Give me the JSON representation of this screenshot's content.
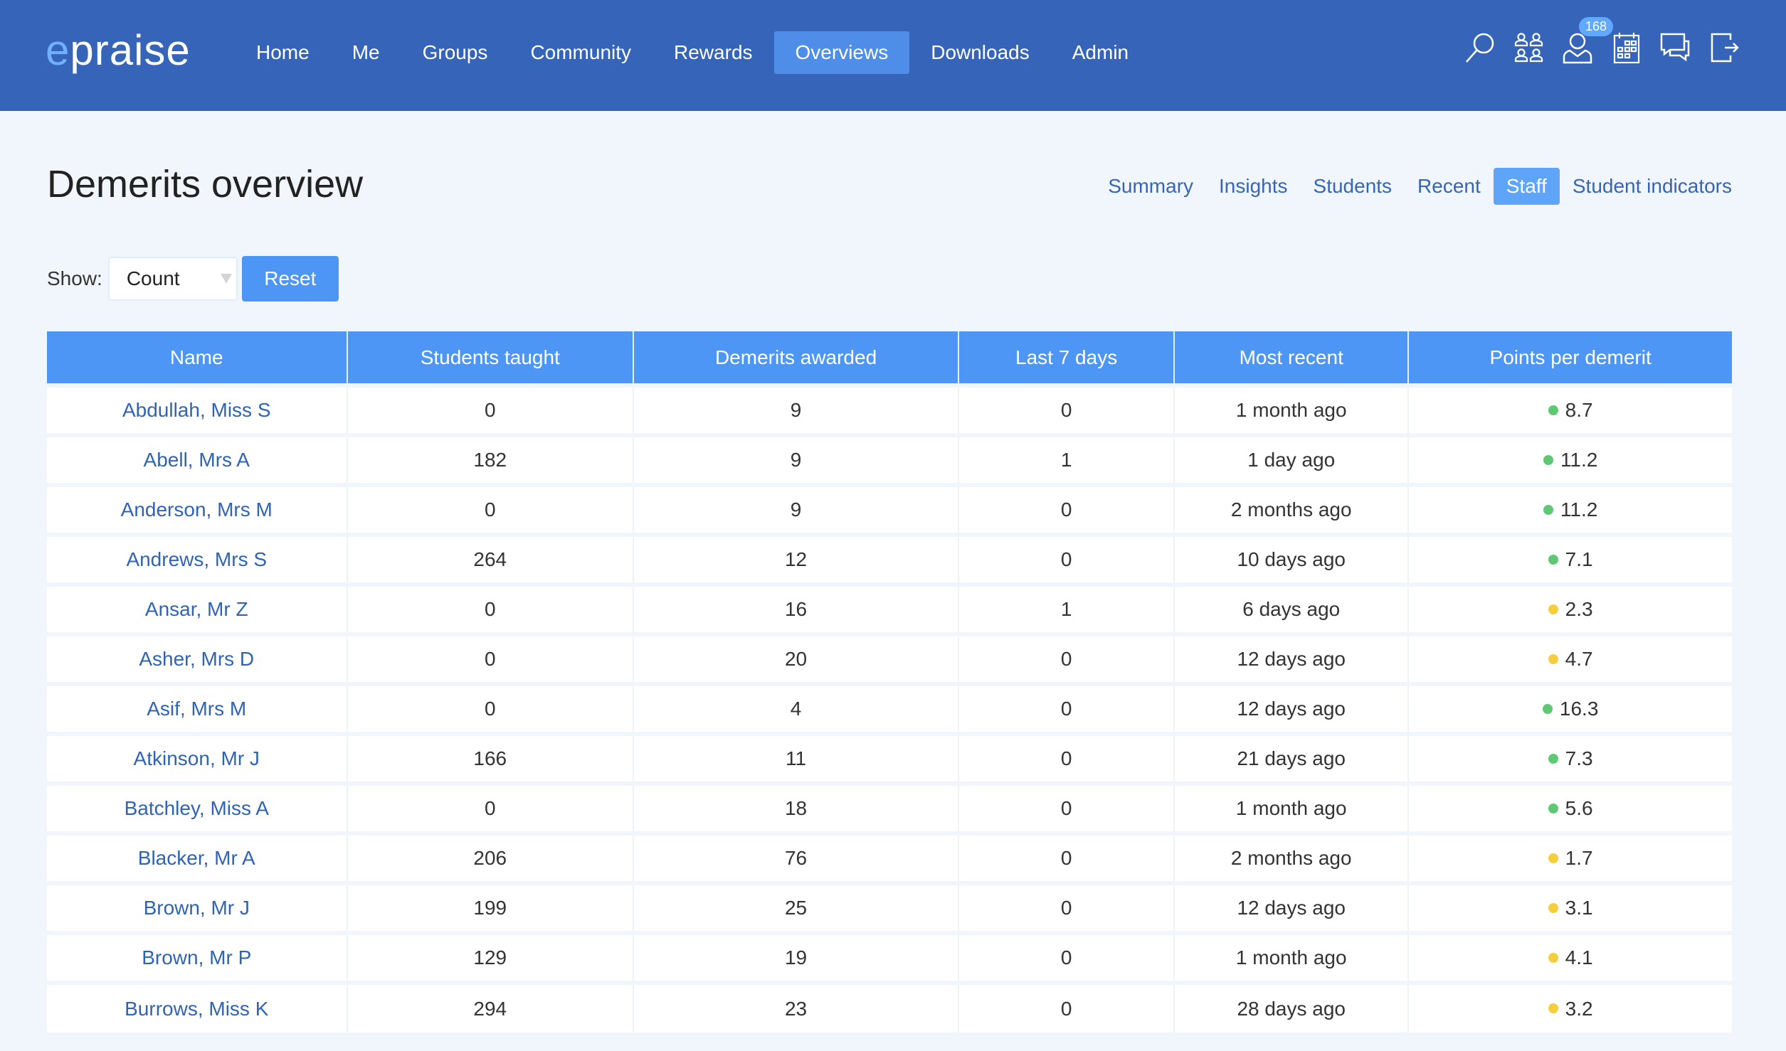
{
  "header": {
    "logo_e": "e",
    "logo_rest": "praise",
    "nav": [
      {
        "label": "Home",
        "active": false
      },
      {
        "label": "Me",
        "active": false
      },
      {
        "label": "Groups",
        "active": false
      },
      {
        "label": "Community",
        "active": false
      },
      {
        "label": "Rewards",
        "active": false
      },
      {
        "label": "Overviews",
        "active": true
      },
      {
        "label": "Downloads",
        "active": false
      },
      {
        "label": "Admin",
        "active": false
      }
    ],
    "icons": [
      "search-icon",
      "groups-icon",
      "user-icon",
      "calendar-icon",
      "messages-icon",
      "logout-icon"
    ],
    "notification_count": "168"
  },
  "page": {
    "title": "Demerits overview",
    "subnav": [
      {
        "label": "Summary",
        "active": false
      },
      {
        "label": "Insights",
        "active": false
      },
      {
        "label": "Students",
        "active": false
      },
      {
        "label": "Recent",
        "active": false
      },
      {
        "label": "Staff",
        "active": true
      },
      {
        "label": "Student indicators",
        "active": false
      }
    ]
  },
  "controls": {
    "show_label": "Show:",
    "show_value": "Count",
    "reset_label": "Reset"
  },
  "colors": {
    "green": "#5ec874",
    "yellow": "#f4ce3d",
    "header_bg": "#3564b8",
    "accent": "#4e96f6"
  },
  "table": {
    "columns": [
      "Name",
      "Students taught",
      "Demerits awarded",
      "Last 7 days",
      "Most recent",
      "Points per demerit"
    ],
    "rows": [
      {
        "name": "Abdullah, Miss S",
        "students": "0",
        "demerits": "9",
        "last7": "0",
        "recent": "1 month ago",
        "ppd": "8.7",
        "status": "green"
      },
      {
        "name": "Abell, Mrs A",
        "students": "182",
        "demerits": "9",
        "last7": "1",
        "recent": "1 day ago",
        "ppd": "11.2",
        "status": "green"
      },
      {
        "name": "Anderson, Mrs M",
        "students": "0",
        "demerits": "9",
        "last7": "0",
        "recent": "2 months ago",
        "ppd": "11.2",
        "status": "green"
      },
      {
        "name": "Andrews, Mrs S",
        "students": "264",
        "demerits": "12",
        "last7": "0",
        "recent": "10 days ago",
        "ppd": "7.1",
        "status": "green"
      },
      {
        "name": "Ansar, Mr Z",
        "students": "0",
        "demerits": "16",
        "last7": "1",
        "recent": "6 days ago",
        "ppd": "2.3",
        "status": "yellow"
      },
      {
        "name": "Asher, Mrs D",
        "students": "0",
        "demerits": "20",
        "last7": "0",
        "recent": "12 days ago",
        "ppd": "4.7",
        "status": "yellow"
      },
      {
        "name": "Asif, Mrs M",
        "students": "0",
        "demerits": "4",
        "last7": "0",
        "recent": "12 days ago",
        "ppd": "16.3",
        "status": "green"
      },
      {
        "name": "Atkinson, Mr J",
        "students": "166",
        "demerits": "11",
        "last7": "0",
        "recent": "21 days ago",
        "ppd": "7.3",
        "status": "green"
      },
      {
        "name": "Batchley, Miss A",
        "students": "0",
        "demerits": "18",
        "last7": "0",
        "recent": "1 month ago",
        "ppd": "5.6",
        "status": "green"
      },
      {
        "name": "Blacker, Mr A",
        "students": "206",
        "demerits": "76",
        "last7": "0",
        "recent": "2 months ago",
        "ppd": "1.7",
        "status": "yellow"
      },
      {
        "name": "Brown, Mr J",
        "students": "199",
        "demerits": "25",
        "last7": "0",
        "recent": "12 days ago",
        "ppd": "3.1",
        "status": "yellow"
      },
      {
        "name": "Brown, Mr P",
        "students": "129",
        "demerits": "19",
        "last7": "0",
        "recent": "1 month ago",
        "ppd": "4.1",
        "status": "yellow"
      },
      {
        "name": "Burrows, Miss K",
        "students": "294",
        "demerits": "23",
        "last7": "0",
        "recent": "28 days ago",
        "ppd": "3.2",
        "status": "yellow"
      }
    ]
  }
}
